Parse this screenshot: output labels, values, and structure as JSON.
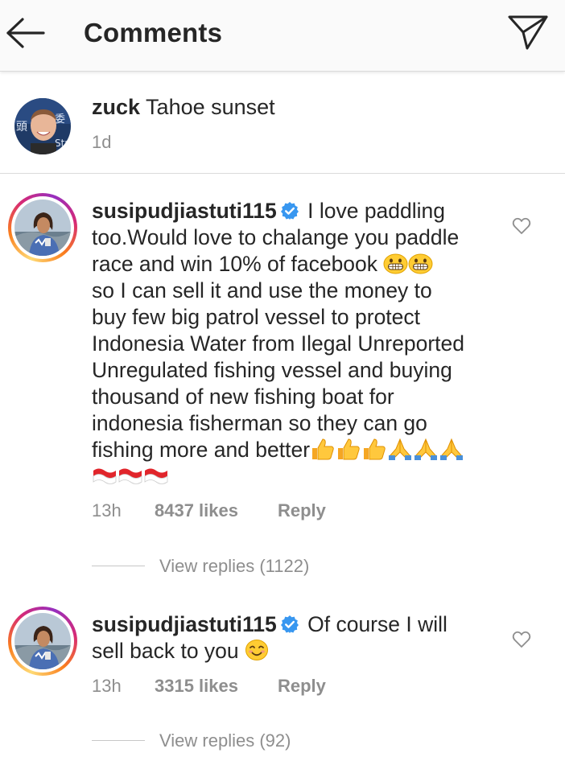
{
  "header": {
    "title": "Comments",
    "back_icon": "arrow-left-icon",
    "share_icon": "paper-plane-icon"
  },
  "caption": {
    "username": "zuck",
    "text": "Tahoe sunset",
    "time": "1d"
  },
  "comments": [
    {
      "username": "susipudjiastuti115",
      "verified": true,
      "lines": [
        " I love paddling",
        "too.Would love to chalange you paddle",
        "race and win 10% of facebook ",
        "so I can sell it and use the money to",
        "buy few big patrol vessel to protect",
        "Indonesia Water from Ilegal Unreported",
        "Unregulated fishing vessel and buying",
        "thousand of new fishing boat for",
        "indonesia fisherman so they can go",
        "fishing more and better"
      ],
      "emojis": [
        "grinning-face",
        "thumbs-up",
        "folded-hands",
        "indonesia-flag"
      ],
      "time": "13h",
      "likes": "8437 likes",
      "reply": "Reply",
      "view_replies": "View replies (1122)"
    },
    {
      "username": "susipudjiastuti115",
      "verified": true,
      "lines": [
        " Of course I will",
        "sell back  to you "
      ],
      "emojis": [
        "smiling-face"
      ],
      "time": "13h",
      "likes": "3315 likes",
      "reply": "Reply",
      "view_replies": "View replies (92)"
    }
  ],
  "colors": {
    "text": "#262626",
    "secondary": "#8e8e8e",
    "verified": "#3897f0",
    "divider": "#dbdbdb"
  }
}
